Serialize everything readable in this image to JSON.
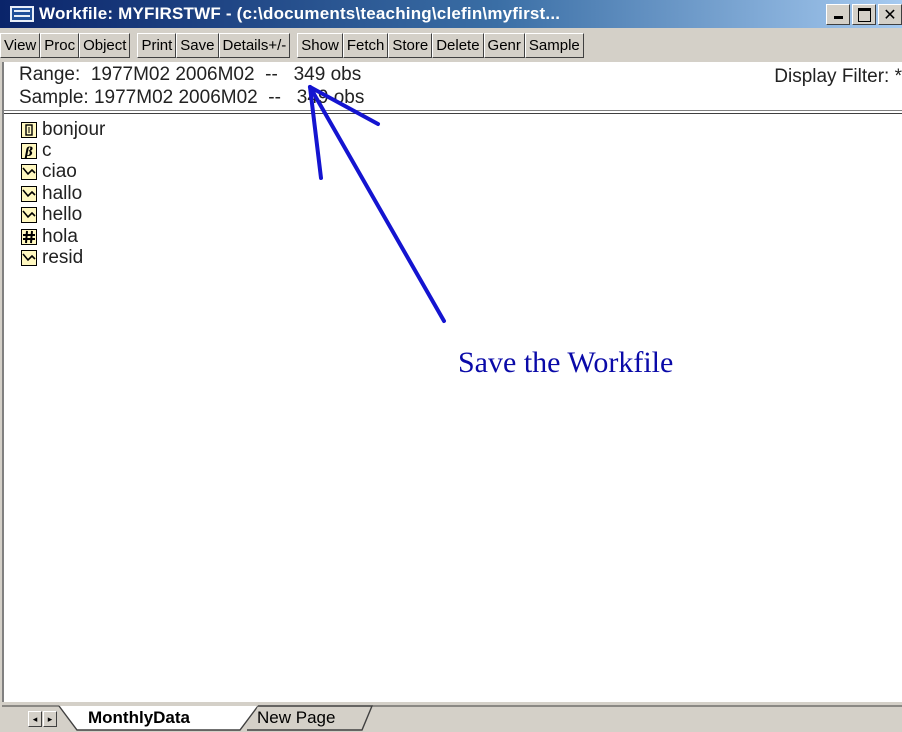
{
  "window": {
    "title": "Workfile: MYFIRSTWF - (c:\\documents\\teaching\\clefin\\myfirst...",
    "close_glyph": "✕"
  },
  "toolbar": {
    "buttons": [
      "View",
      "Proc",
      "Object",
      "Print",
      "Save",
      "Details+/-",
      "Show",
      "Fetch",
      "Store",
      "Delete",
      "Genr",
      "Sample"
    ]
  },
  "info": {
    "range_line": "Range:  1977M02 2006M02  --   349 obs",
    "sample_line": "Sample: 1977M02 2006M02  --   349 obs",
    "display_filter": "Display Filter: *"
  },
  "objects": [
    {
      "name": "bonjour",
      "icon": "coef-vector-icon"
    },
    {
      "name": "c",
      "icon": "beta-coef-icon"
    },
    {
      "name": "ciao",
      "icon": "series-icon"
    },
    {
      "name": "hallo",
      "icon": "series-icon"
    },
    {
      "name": "hello",
      "icon": "series-icon"
    },
    {
      "name": "hola",
      "icon": "equation-icon"
    },
    {
      "name": "resid",
      "icon": "series-icon"
    }
  ],
  "annotation": {
    "text": "Save the Workfile",
    "color": "#0a0aa8"
  },
  "tabs": {
    "active": "MonthlyData",
    "new_page": "New Page"
  },
  "colors": {
    "titlebar_start": "#0a246a",
    "titlebar_end": "#a6caf0",
    "chrome": "#d4d0c8",
    "arrow": "#1414d0"
  }
}
